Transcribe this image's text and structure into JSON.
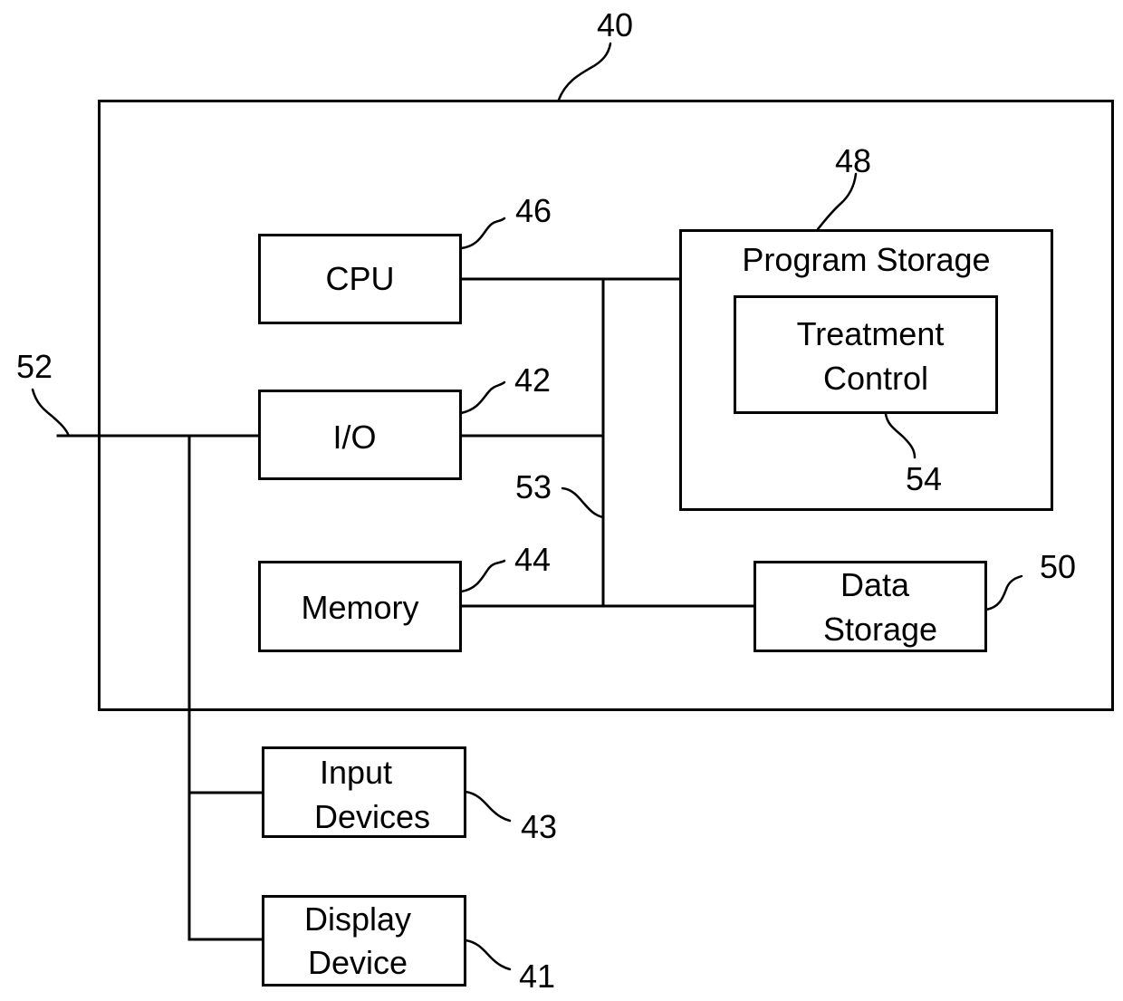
{
  "figure": {
    "outer_ref": "40",
    "bus_external_ref": "52",
    "bus_internal_ref": "53",
    "blocks": {
      "cpu": {
        "label": "CPU",
        "ref": "46"
      },
      "io": {
        "label": "I/O",
        "ref": "42"
      },
      "memory": {
        "label": "Memory",
        "ref": "44"
      },
      "program_storage": {
        "label": "Program Storage",
        "ref": "48"
      },
      "treatment_control": {
        "label_line1": "Treatment",
        "label_line2": "Control",
        "ref": "54"
      },
      "data_storage": {
        "label_line1": "Data",
        "label_line2": "Storage",
        "ref": "50"
      },
      "input_devices": {
        "label_line1": "Input",
        "label_line2": "Devices",
        "ref": "43"
      },
      "display_device": {
        "label_line1": "Display",
        "label_line2": "Device",
        "ref": "41"
      }
    },
    "colors": {
      "line": "#000000",
      "background": "#ffffff"
    }
  }
}
